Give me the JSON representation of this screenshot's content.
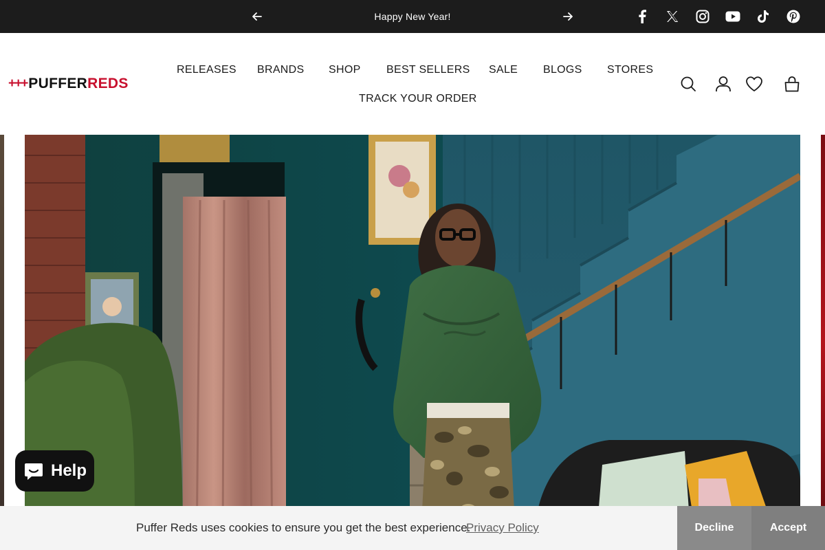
{
  "announcement": {
    "message": "Happy New Year!",
    "prev_icon": "arrow-left-icon",
    "next_icon": "arrow-right-icon"
  },
  "social": [
    "facebook-icon",
    "x-twitter-icon",
    "instagram-icon",
    "youtube-icon",
    "tiktok-icon",
    "pinterest-icon"
  ],
  "logo": {
    "plus": "+++",
    "part1": "PUFFER",
    "part2": "REDS"
  },
  "nav": {
    "releases": "RELEASES",
    "brands": "BRANDS",
    "shop": "SHOP",
    "best_sellers": "BEST SELLERS",
    "sale": "SALE",
    "blogs": "BLOGS",
    "stores": "STORES",
    "track_order": "TRACK YOUR ORDER"
  },
  "header_icons": [
    "search-icon",
    "account-icon",
    "wishlist-heart-icon",
    "cart-bag-icon"
  ],
  "help": {
    "label": "Help",
    "icon": "chat-bubble-icon"
  },
  "cookie": {
    "message": "Puffer Reds uses cookies to ensure you get the best experience.",
    "policy_link": "Privacy Policy",
    "decline": "Decline",
    "accept": "Accept"
  },
  "colors": {
    "announcement_bg": "#1c1c1c",
    "brand_red": "#c8102e",
    "cookie_bg": "#f4f4f4",
    "decline_bg": "#8a8a8a",
    "accept_bg": "#7f7f7f"
  }
}
